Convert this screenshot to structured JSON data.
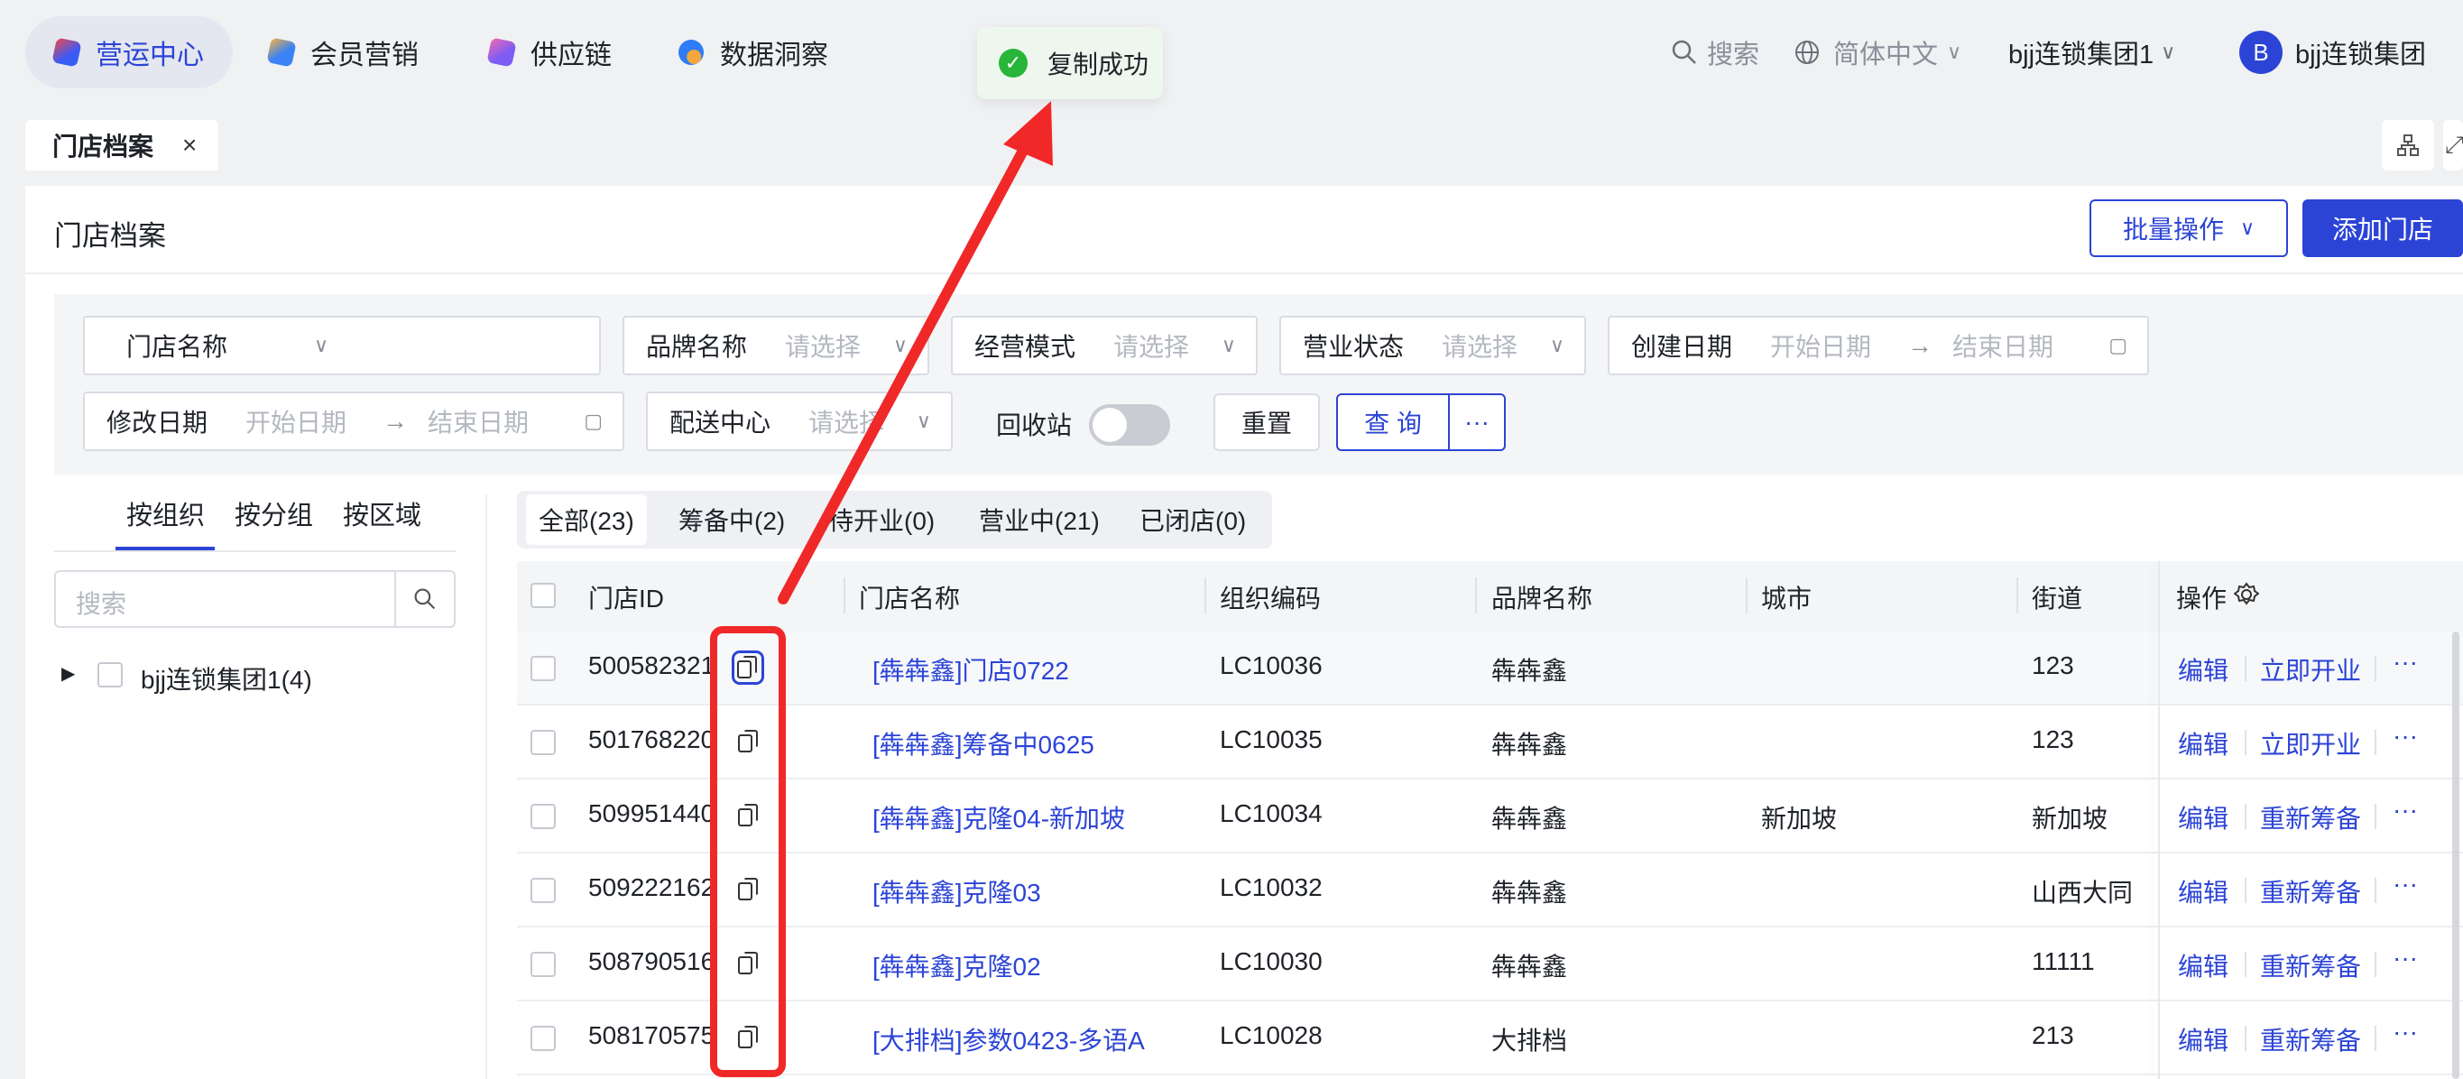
{
  "nav": {
    "items": [
      {
        "label": "营运中心",
        "icon": "ops-center-icon",
        "color": "#3b5bf5",
        "active": true
      },
      {
        "label": "会员营销",
        "icon": "member-marketing-icon",
        "color": "#3b82f6"
      },
      {
        "label": "供应链",
        "icon": "supply-chain-icon",
        "color": "#7c5cf5"
      },
      {
        "label": "数据洞察",
        "icon": "data-insight-icon",
        "color": "#2f7cf6"
      }
    ],
    "search_label": "搜索",
    "language": "简体中文",
    "org": "bjj连锁集团1",
    "avatar_letter": "B",
    "user": "bjj连锁集团"
  },
  "toast": {
    "text": "复制成功"
  },
  "page_tab": {
    "label": "门店档案",
    "close": "×"
  },
  "card": {
    "title": "门店档案",
    "batch_label": "批量操作",
    "add_label": "添加门店"
  },
  "filters": {
    "store_name": "门店名称",
    "brand": "品牌名称",
    "brand_ph": "请选择",
    "mode": "经营模式",
    "mode_ph": "请选择",
    "status": "营业状态",
    "status_ph": "请选择",
    "created": "创建日期",
    "start_ph": "开始日期",
    "end_ph": "结束日期",
    "modified": "修改日期",
    "dist": "配送中心",
    "dist_ph": "请选择",
    "recycle": "回收站",
    "reset": "重置",
    "query": "查 询",
    "more": "···"
  },
  "left": {
    "tabs": [
      "按组织",
      "按分组",
      "按区域"
    ],
    "search_ph": "搜索",
    "tree_item": "bjj连锁集团1(4)"
  },
  "status_tabs": [
    "全部(23)",
    "筹备中(2)",
    "待开业(0)",
    "营业中(21)",
    "已闭店(0)"
  ],
  "table": {
    "columns": [
      "门店ID",
      "门店名称",
      "组织编码",
      "品牌名称",
      "城市",
      "街道",
      "操作"
    ],
    "rows": [
      {
        "id": "500582321",
        "name": "[犇犇鑫]门店0722",
        "code": "LC10036",
        "brand": "犇犇鑫",
        "city": "",
        "street": "123",
        "op1": "编辑",
        "op2": "立即开业"
      },
      {
        "id": "501768220",
        "name": "[犇犇鑫]筹备中0625",
        "code": "LC10035",
        "brand": "犇犇鑫",
        "city": "",
        "street": "123",
        "op1": "编辑",
        "op2": "立即开业"
      },
      {
        "id": "509951440",
        "name": "[犇犇鑫]克隆04-新加坡",
        "code": "LC10034",
        "brand": "犇犇鑫",
        "city": "新加坡",
        "street": "新加坡",
        "op1": "编辑",
        "op2": "重新筹备"
      },
      {
        "id": "509222162",
        "name": "[犇犇鑫]克隆03",
        "code": "LC10032",
        "brand": "犇犇鑫",
        "city": "",
        "street": "山西大同",
        "op1": "编辑",
        "op2": "重新筹备"
      },
      {
        "id": "508790516",
        "name": "[犇犇鑫]克隆02",
        "code": "LC10030",
        "brand": "犇犇鑫",
        "city": "",
        "street": "11111",
        "op1": "编辑",
        "op2": "重新筹备"
      },
      {
        "id": "508170575",
        "name": "[大排档]参数0423-多语A",
        "code": "LC10028",
        "brand": "大排档",
        "city": "",
        "street": "213",
        "op1": "编辑",
        "op2": "重新筹备"
      }
    ],
    "more": "···"
  },
  "colors": {
    "accent": "#2c44d6",
    "annotation": "#f02828",
    "success": "#27b53a"
  }
}
